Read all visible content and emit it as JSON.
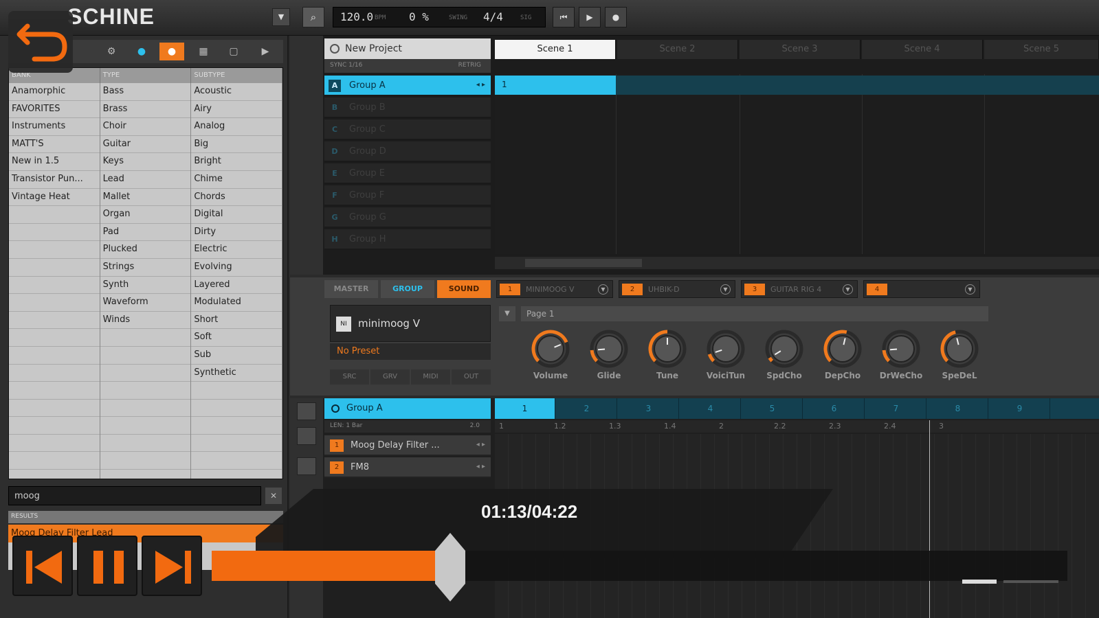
{
  "app": {
    "logo": "SCHINE",
    "tempo": "120.0",
    "tempo_label": "BPM",
    "swing": "0 %",
    "swing_label": "SWING",
    "signature": "4/4",
    "sig_label": "SIG"
  },
  "browser": {
    "headers": [
      "BANK",
      "TYPE",
      "SUBTYPE"
    ],
    "bank": [
      "Anamorphic",
      "FAVORITES",
      "Instruments",
      "MATT'S",
      "New in 1.5",
      "Transistor Pun...",
      "Vintage Heat"
    ],
    "type": [
      "Bass",
      "Brass",
      "Choir",
      "Guitar",
      "Keys",
      "Lead",
      "Mallet",
      "Organ",
      "Pad",
      "Plucked",
      "Strings",
      "Synth",
      "Waveform",
      "Winds"
    ],
    "subtype": [
      "Acoustic",
      "Airy",
      "Analog",
      "Big",
      "Bright",
      "Chime",
      "Chords",
      "Digital",
      "Dirty",
      "Electric",
      "Evolving",
      "Layered",
      "Modulated",
      "Short",
      "Soft",
      "Sub",
      "Synthetic"
    ],
    "search_value": "moog",
    "results_label": "RESULTS",
    "result": "Moog Delay Filter Lead"
  },
  "arranger": {
    "project": "New Project",
    "sync_label": "SYNC 1/16",
    "retrig_label": "RETRIG",
    "scenes": [
      "Scene 1",
      "Scene 2",
      "Scene 3",
      "Scene 4",
      "Scene 5"
    ],
    "groups": [
      {
        "letter": "A",
        "name": "Group A"
      },
      {
        "letter": "B",
        "name": "Group B"
      },
      {
        "letter": "C",
        "name": "Group C"
      },
      {
        "letter": "D",
        "name": "Group D"
      },
      {
        "letter": "E",
        "name": "Group E"
      },
      {
        "letter": "F",
        "name": "Group F"
      },
      {
        "letter": "G",
        "name": "Group G"
      },
      {
        "letter": "H",
        "name": "Group H"
      }
    ],
    "clip_label": "1"
  },
  "control": {
    "tabs": [
      "MASTER",
      "GROUP",
      "SOUND"
    ],
    "plugins": [
      {
        "num": "1",
        "name": "MINIMOOG V"
      },
      {
        "num": "2",
        "name": "UHBIK-D"
      },
      {
        "num": "3",
        "name": "GUITAR RIG 4"
      },
      {
        "num": "4",
        "name": ""
      }
    ],
    "instrument": "minimoog V",
    "instrument_icon": "NI",
    "preset": "No Preset",
    "io": [
      "SRC",
      "GRV",
      "MIDI",
      "OUT"
    ],
    "page": "Page 1",
    "knobs": [
      {
        "label": "Volume",
        "value": 0.75
      },
      {
        "label": "Glide",
        "value": 0.15
      },
      {
        "label": "Tune",
        "value": 0.5
      },
      {
        "label": "VoiciTun",
        "value": 0.1
      },
      {
        "label": "SpdCho",
        "value": 0.05
      },
      {
        "label": "DepCho",
        "value": 0.55
      },
      {
        "label": "DrWeCho",
        "value": 0.15
      },
      {
        "label": "SpeDeL",
        "value": 0.45
      }
    ]
  },
  "pattern": {
    "group": "Group A",
    "pattern_tabs": [
      "1",
      "2",
      "3",
      "4",
      "5",
      "6",
      "7",
      "8",
      "9"
    ],
    "length_label": "LEN: 1 Bar",
    "zoom_label": "2.0",
    "ruler": [
      "1",
      "1.2",
      "1.3",
      "1.4",
      "2",
      "2.2",
      "2.3",
      "2.4",
      "3"
    ],
    "sounds": [
      {
        "num": "1",
        "name": "Moog Delay Filter ..."
      },
      {
        "num": "2",
        "name": "FM8"
      }
    ]
  },
  "player": {
    "timecode": "01:13/04:22",
    "progress": 0.279,
    "accent": "#f26a10"
  }
}
